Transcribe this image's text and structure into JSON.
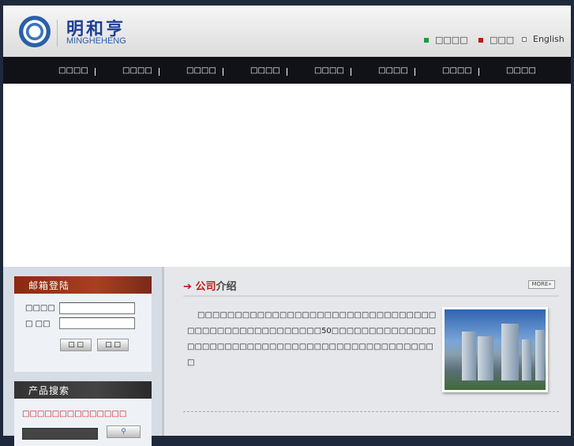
{
  "header": {
    "brand_cn": "明和亨",
    "brand_en": "MINGHEHENG",
    "languages": [
      {
        "label": "□□□□",
        "color": "#1e9a3a"
      },
      {
        "label": "□□□",
        "color": "#c0161b"
      },
      {
        "label": "English",
        "color": "#ffffff"
      }
    ]
  },
  "nav": {
    "items": [
      "□□□□",
      "□□□□",
      "□□□□",
      "□□□□",
      "□□□□",
      "□□□□",
      "□□□□",
      "□□□□"
    ]
  },
  "login": {
    "title": "邮箱登陆",
    "user_label": "□□□□",
    "pass_label": "□ □□",
    "user_value": "",
    "pass_value": "",
    "login_button": "□ □",
    "reset_button": "□ □"
  },
  "search": {
    "title": "产品搜索",
    "hint": "□□□□□□□□□□□□□□",
    "search_value": ""
  },
  "about": {
    "arrow": "➔",
    "title_red": "公司",
    "title_dark": "介绍",
    "more": "MORE»",
    "text": "□□□□□□□□□□□□□□□□□□□□□□□□□□□□□□□□□□□□□□□□□□□□□□□□□□50□□□□□□□□□□□□□□□□□□□□□□□□□□□□□□□□□□□□□□□□□□□□□□□□"
  },
  "colors": {
    "page_bg": "#1e2a3c",
    "nav_bg": "#111118",
    "login_head": "#8a2a10",
    "search_head": "#3a3a3a",
    "accent_red": "#c0161b"
  }
}
